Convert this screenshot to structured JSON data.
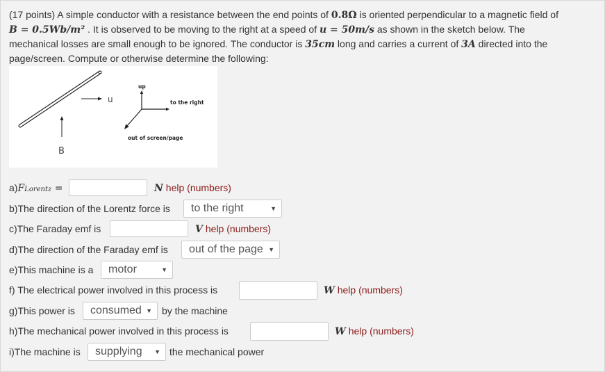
{
  "problem": {
    "points": "(17 points)",
    "p1": " A simple conductor with a resistance between the end points of ",
    "resistance": "0.8Ω",
    "p2": " is oriented perpendicular to a magnetic field of",
    "b_eq": "B = 0.5Wb/m²",
    "p3": " . It is observed to be moving to the right at a speed of ",
    "u_eq": "u = 50m/s",
    "p4": " as shown in the sketch below. The",
    "p5": "mechanical losses are small enough to be ignored. The conductor is ",
    "length": "35cm",
    "p6": " long and carries a current of ",
    "current": "3A",
    "p7": " directed into the",
    "p8": "page/screen. Compute or otherwise determine the following:"
  },
  "figure": {
    "u_label": "u",
    "b_label": "B",
    "up_label": "up",
    "right_label": "to the right",
    "out_label": "out of screen/page"
  },
  "questions": {
    "a": {
      "prefix": "a)",
      "var": "F",
      "sub": "Lorentz",
      "eq": " =",
      "value": "",
      "unit": "N",
      "help": "help (numbers)"
    },
    "b": {
      "label": "b)The direction of the Lorentz force is",
      "selected": "to the right"
    },
    "c": {
      "label": "c)The Faraday emf is",
      "value": "",
      "unit": "V",
      "help": "help (numbers)"
    },
    "d": {
      "label": "d)The direction of the Faraday emf is",
      "selected": "out of the page"
    },
    "e": {
      "label": "e)This machine is a",
      "selected": "motor"
    },
    "f": {
      "label": "f) The electrical power involved in this process is",
      "value": "",
      "unit": "W",
      "help": "help (numbers)"
    },
    "g": {
      "label": "g)This power is",
      "selected": "consumed",
      "suffix": "by the machine"
    },
    "h": {
      "label": "h)The mechanical power involved in this process is",
      "value": "",
      "unit": "W",
      "help": "help (numbers)"
    },
    "i": {
      "label": "i)The machine is",
      "selected": "supplying",
      "suffix": "the mechanical power"
    }
  }
}
